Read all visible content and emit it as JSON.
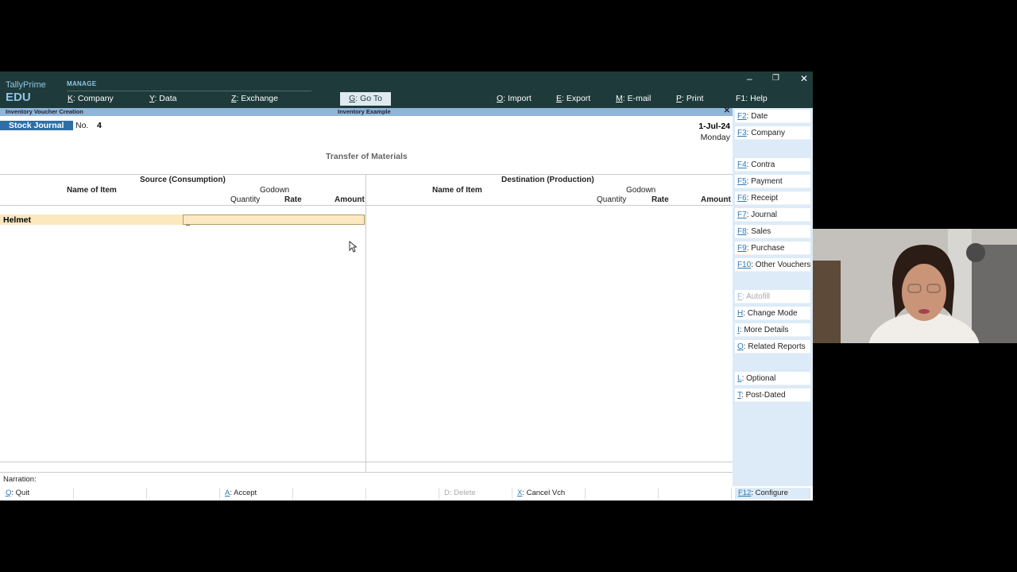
{
  "app": {
    "brand": "TallyPrime",
    "edition": "EDU",
    "section": "MANAGE"
  },
  "menu": [
    {
      "key": "K",
      "label": "Company"
    },
    {
      "key": "Y",
      "label": "Data"
    },
    {
      "key": "Z",
      "label": "Exchange"
    },
    {
      "key": "G",
      "label": "Go To"
    },
    {
      "key": "O",
      "label": "Import"
    },
    {
      "key": "E",
      "label": "Export"
    },
    {
      "key": "M",
      "label": "E-mail"
    },
    {
      "key": "P",
      "label": "Print"
    },
    {
      "key": "F1",
      "label": "Help"
    }
  ],
  "window": {
    "minimize": "–",
    "restore": "❐",
    "close": "✕"
  },
  "subbar": {
    "left": "Inventory Voucher Creation",
    "center": "Inventory Example",
    "close": "✕"
  },
  "voucher": {
    "type": "Stock Journal",
    "no_label": "No.",
    "number": "4",
    "date": "1-Jul-24",
    "day": "Monday",
    "title": "Transfer of Materials"
  },
  "source": {
    "heading": "Source (Consumption)",
    "name_col": "Name of Item",
    "godown_col": "Godown",
    "qty_col": "Quantity",
    "rate_col": "Rate",
    "amount_col": "Amount",
    "entry": {
      "item": "Helmet",
      "godown_cursor": "_"
    }
  },
  "destination": {
    "heading": "Destination (Production)",
    "name_col": "Name of Item",
    "godown_col": "Godown",
    "qty_col": "Quantity",
    "rate_col": "Rate",
    "amount_col": "Amount"
  },
  "narration_label": "Narration:",
  "bottom": [
    {
      "key": "Q",
      "label": "Quit",
      "disabled": false
    },
    {
      "key": "",
      "label": "",
      "disabled": false
    },
    {
      "key": "",
      "label": "",
      "disabled": false
    },
    {
      "key": "A",
      "label": "Accept",
      "disabled": false
    },
    {
      "key": "",
      "label": "",
      "disabled": false
    },
    {
      "key": "",
      "label": "",
      "disabled": false
    },
    {
      "key": "D",
      "label": "Delete",
      "disabled": true
    },
    {
      "key": "X",
      "label": "Cancel Vch",
      "disabled": false
    },
    {
      "key": "",
      "label": "",
      "disabled": false
    },
    {
      "key": "",
      "label": "",
      "disabled": false
    },
    {
      "key": "F12",
      "label": "Configure",
      "disabled": false
    }
  ],
  "sidebar": [
    {
      "key": "F2",
      "label": "Date",
      "disabled": false
    },
    {
      "key": "F3",
      "label": "Company",
      "disabled": false
    },
    {
      "key": "F4",
      "label": "Contra",
      "disabled": false
    },
    {
      "key": "F5",
      "label": "Payment",
      "disabled": false
    },
    {
      "key": "F6",
      "label": "Receipt",
      "disabled": false
    },
    {
      "key": "F7",
      "label": "Journal",
      "disabled": false
    },
    {
      "key": "F8",
      "label": "Sales",
      "disabled": false
    },
    {
      "key": "F9",
      "label": "Purchase",
      "disabled": false
    },
    {
      "key": "F10",
      "label": "Other Vouchers",
      "disabled": false
    },
    {
      "key": "F",
      "label": "Autofill",
      "disabled": true
    },
    {
      "key": "H",
      "label": "Change Mode",
      "disabled": false
    },
    {
      "key": "I",
      "label": "More Details",
      "disabled": false
    },
    {
      "key": "O",
      "label": "Related Reports",
      "disabled": false
    },
    {
      "key": "L",
      "label": "Optional",
      "disabled": false
    },
    {
      "key": "T",
      "label": "Post-Dated",
      "disabled": false
    }
  ]
}
